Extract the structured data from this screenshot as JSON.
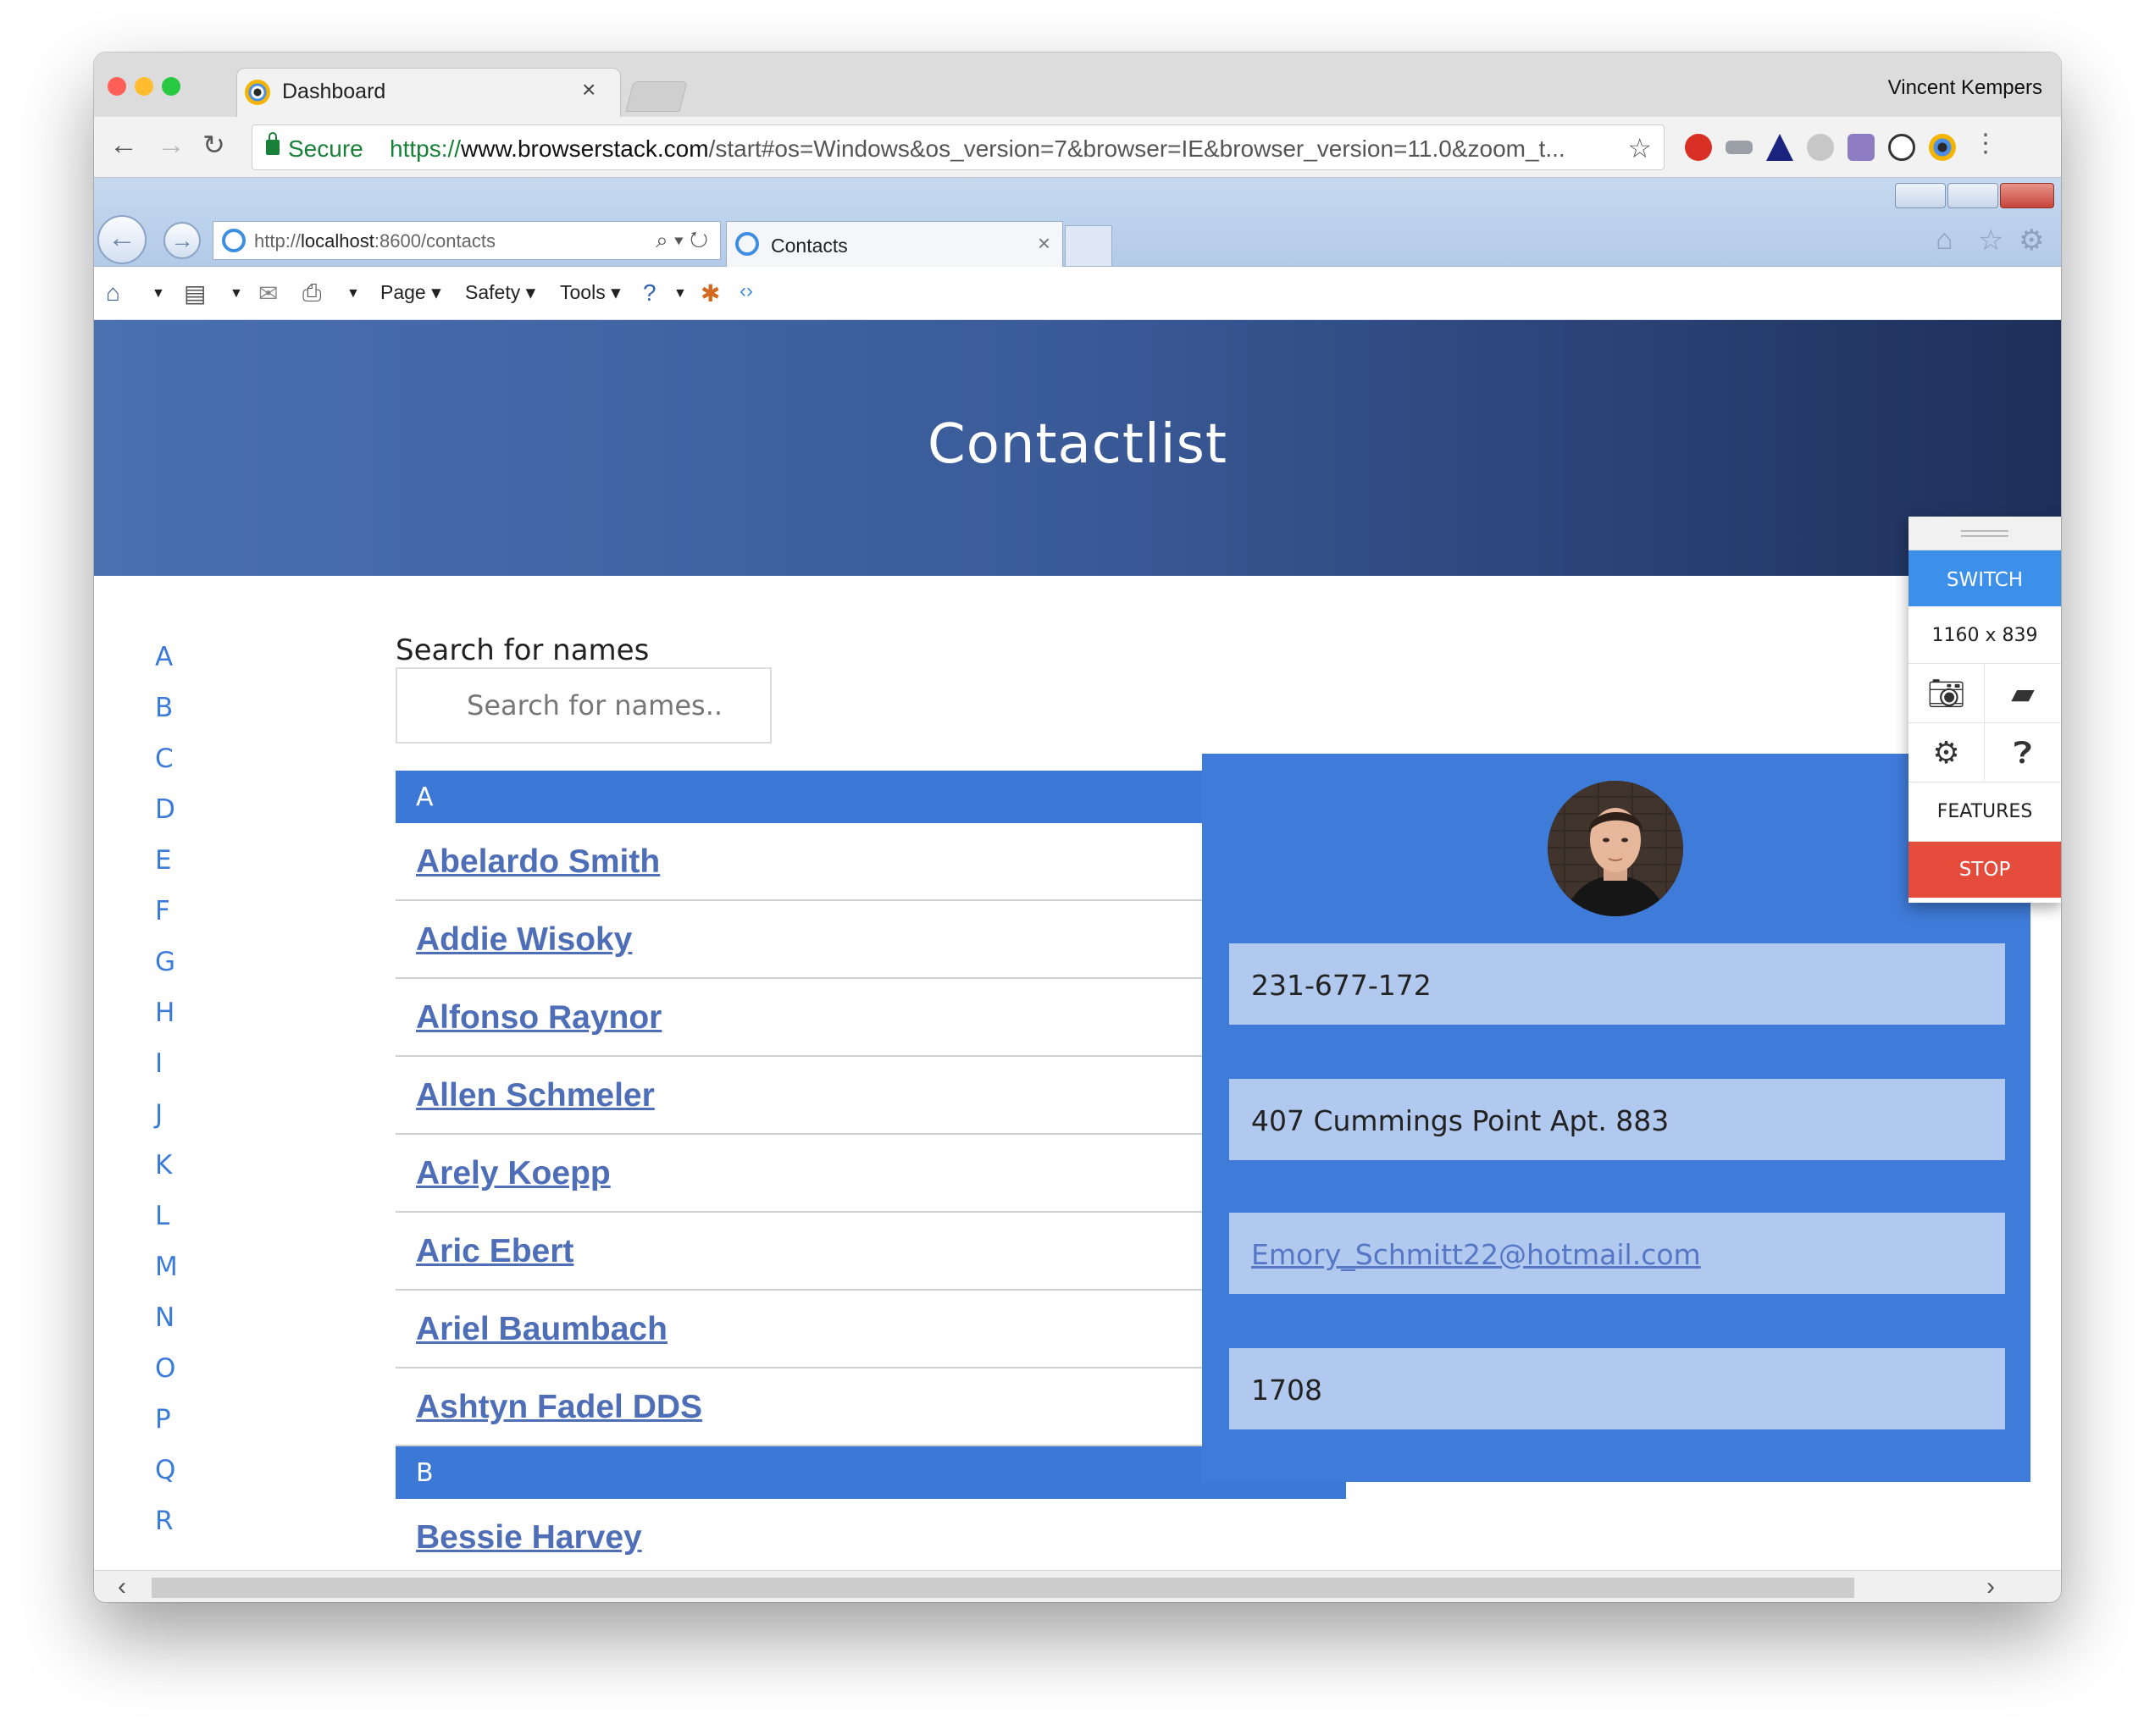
{
  "chrome": {
    "tab_title": "Dashboard",
    "tab_close": "×",
    "profile_name": "Vincent Kempers",
    "secure_label": "Secure",
    "url_scheme": "https://",
    "url_host": "www.browserstack.com",
    "url_rest": "/start#os=Windows&os_version=7&browser=IE&browser_version=11.0&zoom_t...",
    "traffic_colors": [
      "#ff5f57",
      "#febc2e",
      "#28c840"
    ]
  },
  "ie": {
    "address_prefix": "http://",
    "address_host": "localhost",
    "address_rest": ":8600/contacts",
    "tab_title": "Contacts",
    "tab_close": "×",
    "menu": {
      "page": "Page",
      "safety": "Safety",
      "tools": "Tools"
    }
  },
  "page": {
    "title": "Contactlist",
    "alphabet": [
      "A",
      "B",
      "C",
      "D",
      "E",
      "F",
      "G",
      "H",
      "I",
      "J",
      "K",
      "L",
      "M",
      "N",
      "O",
      "P",
      "Q",
      "R"
    ],
    "search": {
      "label": "Search for names",
      "placeholder": "Search for names.."
    },
    "groups": [
      {
        "letter": "A",
        "contacts": [
          "Abelardo Smith",
          "Addie Wisoky",
          "Alfonso Raynor",
          "Allen Schmeler",
          "Arely Koepp",
          "Aric Ebert",
          "Ariel Baumbach",
          "Ashtyn Fadel DDS"
        ]
      },
      {
        "letter": "B",
        "contacts": [
          "Bessie Harvey"
        ]
      }
    ],
    "detail": {
      "phone": "231-677-172",
      "address": "407 Cummings Point Apt. 883",
      "email": "Emory_Schmitt22@hotmail.com",
      "number": "1708"
    }
  },
  "browserstack": {
    "switch": "SWITCH",
    "resolution": "1160 x 839",
    "features": "FEATURES",
    "stop": "STOP"
  },
  "colors": {
    "accent_blue": "#3c79d6",
    "link_blue": "#4e6eb7",
    "stop_red": "#e64c3c"
  }
}
